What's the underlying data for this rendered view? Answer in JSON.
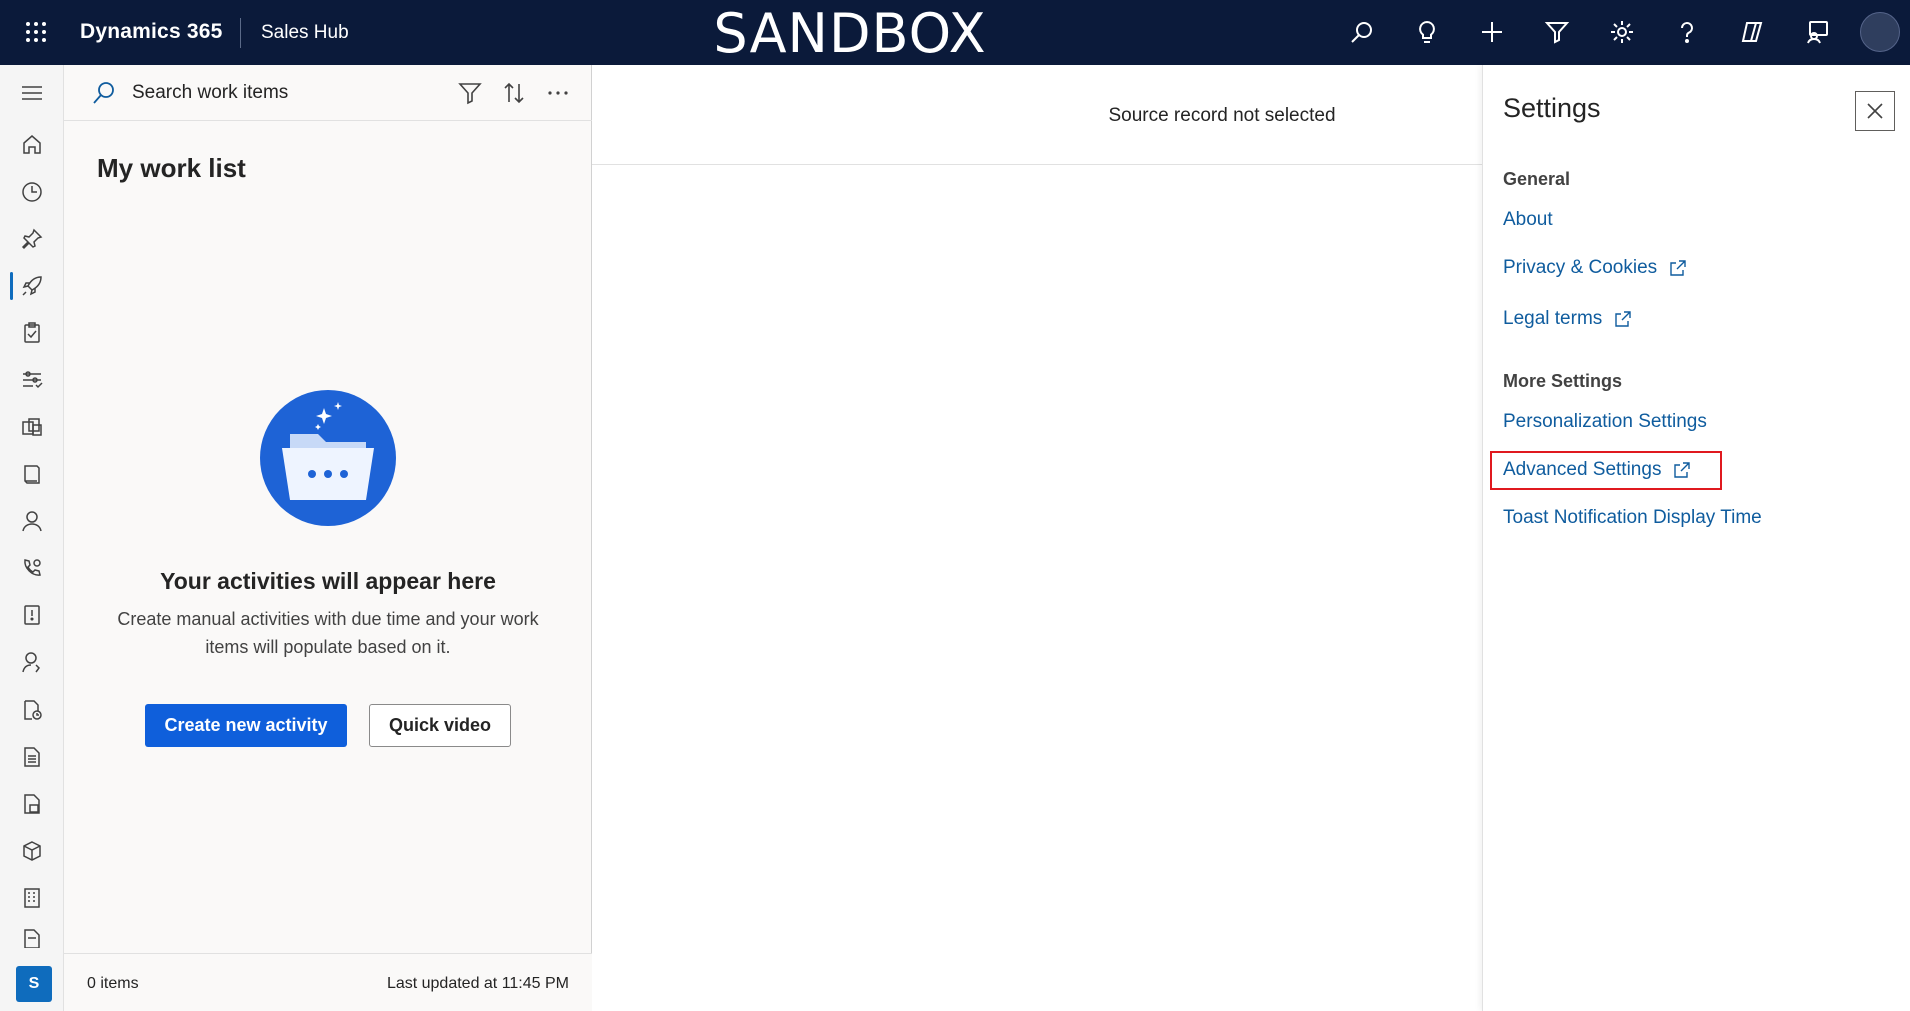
{
  "topbar": {
    "brand": "Dynamics 365",
    "app": "Sales Hub",
    "environment": "SANDBOX",
    "icons": [
      "search-icon",
      "lightbulb-icon",
      "plus-icon",
      "filter-icon",
      "gear-icon",
      "help-icon",
      "copilot-icon",
      "feedback-icon"
    ]
  },
  "rail": {
    "items": [
      "menu-icon",
      "home-icon",
      "recent-icon",
      "pin-icon",
      "rocket-icon",
      "clipboard-icon",
      "sliders-icon",
      "stack-icon",
      "book-icon",
      "person-icon",
      "phone-gear-icon",
      "alert-document-icon",
      "person-badge-icon",
      "document-clock-icon",
      "document-icon",
      "document-stack-icon",
      "cube-icon",
      "building-icon",
      "document-partial-icon"
    ],
    "avatar_initial": "S"
  },
  "worklist": {
    "search_placeholder": "Search work items",
    "title": "My work list",
    "empty_title": "Your activities will appear here",
    "empty_desc": "Create manual activities with due time and your work items will populate based on it.",
    "primary_button": "Create new activity",
    "secondary_button": "Quick video",
    "item_count": "0 items",
    "last_updated": "Last updated at 11:45 PM"
  },
  "main": {
    "source_text": "Source record not selected"
  },
  "settings": {
    "title": "Settings",
    "general_heading": "General",
    "about": "About",
    "privacy": "Privacy & Cookies",
    "legal": "Legal terms",
    "more_heading": "More Settings",
    "personalization": "Personalization Settings",
    "advanced": "Advanced Settings",
    "toast": "Toast Notification Display Time"
  },
  "colors": {
    "topbar_bg": "#0b1a3a",
    "accent": "#0f5fdb",
    "link": "#0f5c9e",
    "highlight": "#e0191f"
  }
}
